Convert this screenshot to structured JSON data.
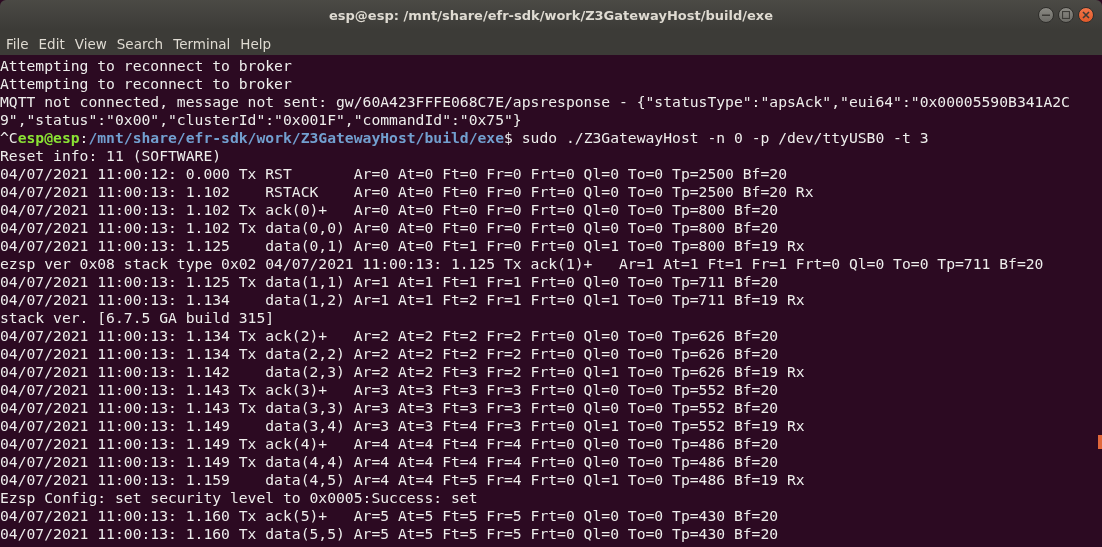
{
  "window": {
    "title": "esp@esp: /mnt/share/efr-sdk/work/Z3GatewayHost/build/exe"
  },
  "menu": [
    "File",
    "Edit",
    "View",
    "Search",
    "Terminal",
    "Help"
  ],
  "lines": [
    {
      "kind": "plain",
      "text": "Attempting to reconnect to broker"
    },
    {
      "kind": "plain",
      "text": "Attempting to reconnect to broker"
    },
    {
      "kind": "plain",
      "text": "MQTT not connected, message not sent: gw/60A423FFFE068C7E/apsresponse - {\"statusType\":\"apsAck\",\"eui64\":\"0x00005590B341A2C"
    },
    {
      "kind": "plain",
      "text": "9\",\"status\":\"0x00\",\"clusterId\":\"0x001F\",\"commandId\":\"0x75\"}"
    },
    {
      "kind": "prompt",
      "prefix": "^C",
      "user": "esp@esp",
      "separator": ":",
      "path": "/mnt/share/efr-sdk/work/Z3GatewayHost/build/exe",
      "command": "$ sudo ./Z3GatewayHost -n 0 -p /dev/ttyUSB0 -t 3"
    },
    {
      "kind": "plain",
      "text": "Reset info: 11 (SOFTWARE)"
    },
    {
      "kind": "plain",
      "text": "04/07/2021 11:00:12: 0.000 Tx RST       Ar=0 At=0 Ft=0 Fr=0 Frt=0 Ql=0 To=0 Tp=2500 Bf=20"
    },
    {
      "kind": "plain",
      "text": "04/07/2021 11:00:13: 1.102    RSTACK    Ar=0 At=0 Ft=0 Fr=0 Frt=0 Ql=0 To=0 Tp=2500 Bf=20 Rx"
    },
    {
      "kind": "plain",
      "text": "04/07/2021 11:00:13: 1.102 Tx ack(0)+   Ar=0 At=0 Ft=0 Fr=0 Frt=0 Ql=0 To=0 Tp=800 Bf=20"
    },
    {
      "kind": "plain",
      "text": "04/07/2021 11:00:13: 1.102 Tx data(0,0) Ar=0 At=0 Ft=0 Fr=0 Frt=0 Ql=0 To=0 Tp=800 Bf=20"
    },
    {
      "kind": "plain",
      "text": "04/07/2021 11:00:13: 1.125    data(0,1) Ar=0 At=0 Ft=1 Fr=0 Frt=0 Ql=1 To=0 Tp=800 Bf=19 Rx"
    },
    {
      "kind": "plain",
      "text": "ezsp ver 0x08 stack type 0x02 04/07/2021 11:00:13: 1.125 Tx ack(1)+   Ar=1 At=1 Ft=1 Fr=1 Frt=0 Ql=0 To=0 Tp=711 Bf=20"
    },
    {
      "kind": "plain",
      "text": "04/07/2021 11:00:13: 1.125 Tx data(1,1) Ar=1 At=1 Ft=1 Fr=1 Frt=0 Ql=0 To=0 Tp=711 Bf=20"
    },
    {
      "kind": "plain",
      "text": "04/07/2021 11:00:13: 1.134    data(1,2) Ar=1 At=1 Ft=2 Fr=1 Frt=0 Ql=1 To=0 Tp=711 Bf=19 Rx"
    },
    {
      "kind": "plain",
      "text": "stack ver. [6.7.5 GA build 315]"
    },
    {
      "kind": "plain",
      "text": "04/07/2021 11:00:13: 1.134 Tx ack(2)+   Ar=2 At=2 Ft=2 Fr=2 Frt=0 Ql=0 To=0 Tp=626 Bf=20"
    },
    {
      "kind": "plain",
      "text": "04/07/2021 11:00:13: 1.134 Tx data(2,2) Ar=2 At=2 Ft=2 Fr=2 Frt=0 Ql=0 To=0 Tp=626 Bf=20"
    },
    {
      "kind": "plain",
      "text": "04/07/2021 11:00:13: 1.142    data(2,3) Ar=2 At=2 Ft=3 Fr=2 Frt=0 Ql=1 To=0 Tp=626 Bf=19 Rx"
    },
    {
      "kind": "plain",
      "text": "04/07/2021 11:00:13: 1.143 Tx ack(3)+   Ar=3 At=3 Ft=3 Fr=3 Frt=0 Ql=0 To=0 Tp=552 Bf=20"
    },
    {
      "kind": "plain",
      "text": "04/07/2021 11:00:13: 1.143 Tx data(3,3) Ar=3 At=3 Ft=3 Fr=3 Frt=0 Ql=0 To=0 Tp=552 Bf=20"
    },
    {
      "kind": "plain",
      "text": "04/07/2021 11:00:13: 1.149    data(3,4) Ar=3 At=3 Ft=4 Fr=3 Frt=0 Ql=1 To=0 Tp=552 Bf=19 Rx"
    },
    {
      "kind": "plain",
      "text": "04/07/2021 11:00:13: 1.149 Tx ack(4)+   Ar=4 At=4 Ft=4 Fr=4 Frt=0 Ql=0 To=0 Tp=486 Bf=20"
    },
    {
      "kind": "plain",
      "text": "04/07/2021 11:00:13: 1.149 Tx data(4,4) Ar=4 At=4 Ft=4 Fr=4 Frt=0 Ql=0 To=0 Tp=486 Bf=20"
    },
    {
      "kind": "plain",
      "text": "04/07/2021 11:00:13: 1.159    data(4,5) Ar=4 At=4 Ft=5 Fr=4 Frt=0 Ql=1 To=0 Tp=486 Bf=19 Rx"
    },
    {
      "kind": "plain",
      "text": "Ezsp Config: set security level to 0x0005:Success: set"
    },
    {
      "kind": "plain",
      "text": "04/07/2021 11:00:13: 1.160 Tx ack(5)+   Ar=5 At=5 Ft=5 Fr=5 Frt=0 Ql=0 To=0 Tp=430 Bf=20"
    },
    {
      "kind": "plain",
      "text": "04/07/2021 11:00:13: 1.160 Tx data(5,5) Ar=5 At=5 Ft=5 Fr=5 Frt=0 Ql=0 To=0 Tp=430 Bf=20"
    }
  ]
}
